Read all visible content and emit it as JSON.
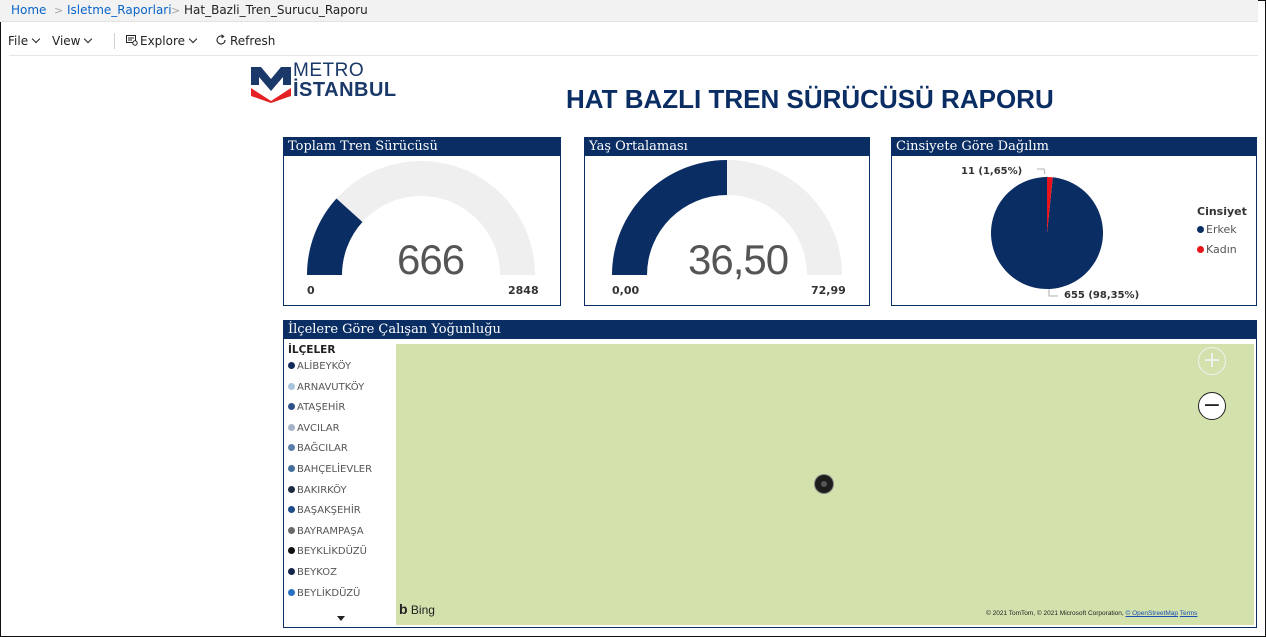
{
  "breadcrumb": {
    "home": "Home",
    "folder": "Isletme_Raporlari",
    "current": "Hat_Bazli_Tren_Surucu_Raporu"
  },
  "toolbar": {
    "file": "File",
    "view": "View",
    "explore": "Explore",
    "refresh": "Refresh"
  },
  "logo": {
    "line1": "METRO",
    "line2": "İSTANBUL"
  },
  "report_title": "HAT BAZLI TREN SÜRÜCÜSÜ RAPORU",
  "colors": {
    "primary": "#0a2d63",
    "gauge_bg": "#f0efef",
    "female": "#e8141b",
    "map": "#d3e1ad"
  },
  "cards": {
    "total": {
      "title": "Toplam Tren Sürücüsü",
      "value": "666",
      "min": "0",
      "max": "2848",
      "fraction": 0.234
    },
    "age": {
      "title": "Yaş Ortalaması",
      "value": "36,50",
      "min": "0,00",
      "max": "72,99",
      "fraction": 0.5
    },
    "gender": {
      "title": "Cinsiyete Göre Dağılım",
      "label_female": "11 (1,65%)",
      "label_male": "655 (98,35%)",
      "legend_title": "Cinsiyet",
      "legend": [
        "Erkek",
        "Kadın"
      ]
    }
  },
  "chart_data": {
    "type": "pie",
    "title": "Cinsiyete Göre Dağılım",
    "categories": [
      "Erkek",
      "Kadın"
    ],
    "values": [
      655,
      11
    ],
    "percentages": [
      98.35,
      1.65
    ],
    "colors": [
      "#0a2d63",
      "#e8141b"
    ],
    "legend_title": "Cinsiyet",
    "legend_position": "right"
  },
  "map": {
    "title": "İlçelere Göre Çalışan Yoğunluğu",
    "legend_title": "İLÇELER",
    "districts": [
      {
        "name": "ALİBEYKÖY",
        "color": "#12295a"
      },
      {
        "name": "ARNAVUTKÖY",
        "color": "#a9c3dc"
      },
      {
        "name": "ATAŞEHİR",
        "color": "#2c4f86"
      },
      {
        "name": "AVCILAR",
        "color": "#a4b4c6"
      },
      {
        "name": "BAĞCILAR",
        "color": "#5a7ea8"
      },
      {
        "name": "BAHÇELİEVLER",
        "color": "#446f9c"
      },
      {
        "name": "BAKIRKÖY",
        "color": "#1c2a44"
      },
      {
        "name": "BAŞAKŞEHİR",
        "color": "#1f4c8c"
      },
      {
        "name": "BAYRAMPAŞA",
        "color": "#6a6a6a"
      },
      {
        "name": "BEYKLİKDÜZÜ",
        "color": "#111111"
      },
      {
        "name": "BEYKOZ",
        "color": "#14244a"
      },
      {
        "name": "BEYLİKDÜZÜ",
        "color": "#2a72c6"
      }
    ],
    "attribution_bing": "Bing",
    "copyright": "© 2021 TomTom, © 2021 Microsoft Corporation,",
    "osm_link": "© OpenStreetMap",
    "terms_link": "Terms"
  }
}
